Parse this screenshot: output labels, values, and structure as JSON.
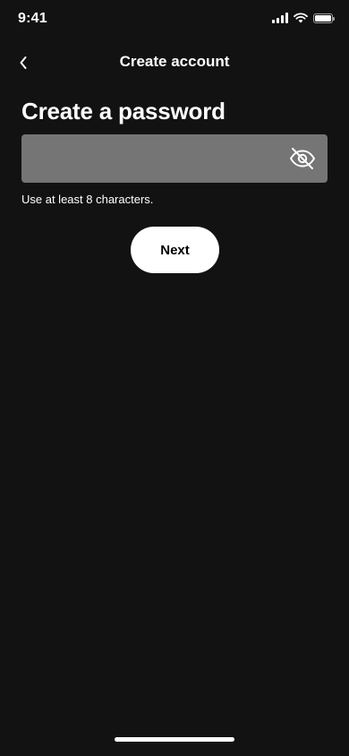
{
  "status_bar": {
    "time": "9:41",
    "icons": [
      "cellular-signal-icon",
      "wifi-icon",
      "battery-icon"
    ]
  },
  "nav": {
    "back_icon": "chevron-left-icon",
    "title": "Create account"
  },
  "form": {
    "heading": "Create a password",
    "password": {
      "value": "",
      "placeholder": "",
      "toggle_icon": "eye-slash-icon"
    },
    "hint": "Use at least 8 characters.",
    "next_label": "Next"
  },
  "colors": {
    "background": "#121212",
    "input_background": "#757575",
    "button_background": "#ffffff",
    "button_text": "#000000",
    "text": "#ffffff"
  }
}
